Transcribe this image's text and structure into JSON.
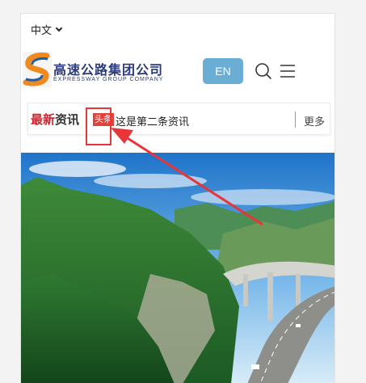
{
  "language": {
    "current": "中文"
  },
  "logo": {
    "name_cn": "高速公路集团公司",
    "name_en": "EXPRESSWAY GROUP COMPANY"
  },
  "header": {
    "en_button": "EN"
  },
  "news": {
    "title_red": "最新",
    "title_dark": "资讯",
    "tag": "头条",
    "headline": "这是第二条资讯",
    "more": "更多"
  },
  "colors": {
    "accent_blue": "#6aaed6",
    "news_red": "#d0202a",
    "annotation_red": "#e8353a"
  },
  "icons": [
    "chevron-down-icon",
    "search-icon",
    "menu-icon"
  ]
}
